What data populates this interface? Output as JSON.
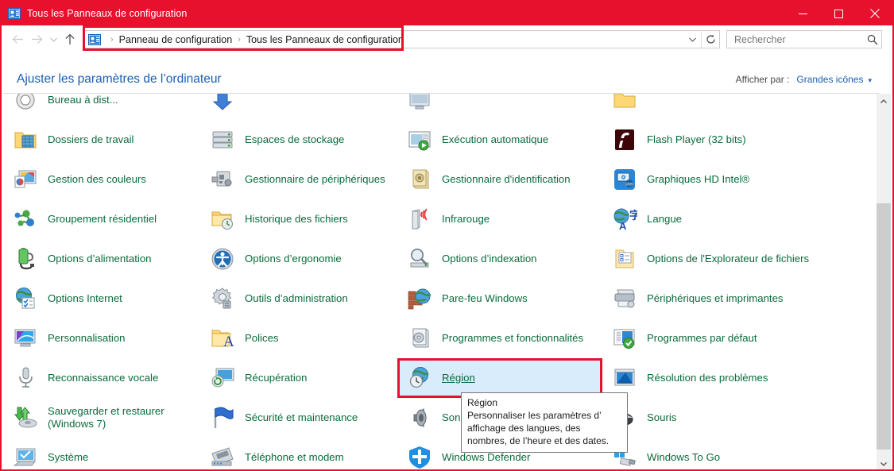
{
  "window": {
    "title": "Tous les Panneaux de configuration",
    "titlebar_color": "#e8112d",
    "icon": "control-panel-icon",
    "minimize_label": "—",
    "maximize_label": "□",
    "close_label": "✕"
  },
  "nav": {
    "back_label": "←",
    "forward_label": "→",
    "recent_label": "⌄",
    "up_label": "↑",
    "refresh_label": "↻",
    "dropdown_label": "⌄",
    "breadcrumb": [
      "Panneau de configuration",
      "Tous les Panneaux de configuration"
    ],
    "separator": "›"
  },
  "search": {
    "placeholder": "Rechercher",
    "value": "",
    "icon": "search-icon"
  },
  "header": {
    "heading": "Ajuster les paramètres de l’ordinateur",
    "view_by_label": "Afficher par :",
    "view_by_value": "Grandes icônes",
    "view_by_caret": "▾"
  },
  "grid": {
    "partial_top_row": [
      {
        "label": "Bureau à dist...",
        "icon": "remote-desktop-icon"
      },
      {
        "label": "",
        "icon": "windows-update-icon"
      },
      {
        "label": "",
        "icon": "display-icon"
      },
      {
        "label": "",
        "icon": "folder-small-icon"
      }
    ],
    "rows": [
      [
        {
          "label": "Dossiers de travail",
          "icon": "work-folders-icon"
        },
        {
          "label": "Espaces de stockage",
          "icon": "storage-spaces-icon"
        },
        {
          "label": "Exécution automatique",
          "icon": "autoplay-icon"
        },
        {
          "label": "Flash Player (32 bits)",
          "icon": "flash-player-icon"
        }
      ],
      [
        {
          "label": "Gestion des couleurs",
          "icon": "color-management-icon"
        },
        {
          "label": "Gestionnaire de périphériques",
          "icon": "device-manager-icon"
        },
        {
          "label": "Gestionnaire d'identification",
          "icon": "credential-manager-icon"
        },
        {
          "label": "Graphiques HD Intel®",
          "icon": "intel-hd-graphics-icon"
        }
      ],
      [
        {
          "label": "Groupement résidentiel",
          "icon": "homegroup-icon"
        },
        {
          "label": "Historique des fichiers",
          "icon": "file-history-icon"
        },
        {
          "label": "Infrarouge",
          "icon": "infrared-icon"
        },
        {
          "label": "Langue",
          "icon": "language-icon"
        }
      ],
      [
        {
          "label": "Options d’alimentation",
          "icon": "power-options-icon"
        },
        {
          "label": "Options d’ergonomie",
          "icon": "ease-of-access-icon"
        },
        {
          "label": "Options d’indexation",
          "icon": "indexing-options-icon"
        },
        {
          "label": "Options de l'Explorateur de fichiers",
          "icon": "file-explorer-options-icon"
        }
      ],
      [
        {
          "label": "Options Internet",
          "icon": "internet-options-icon"
        },
        {
          "label": "Outils d’administration",
          "icon": "admin-tools-icon"
        },
        {
          "label": "Pare-feu Windows",
          "icon": "windows-firewall-icon"
        },
        {
          "label": "Périphériques et imprimantes",
          "icon": "devices-printers-icon"
        }
      ],
      [
        {
          "label": "Personnalisation",
          "icon": "personalization-icon"
        },
        {
          "label": "Polices",
          "icon": "fonts-icon"
        },
        {
          "label": "Programmes et fonctionnalités",
          "icon": "programs-features-icon"
        },
        {
          "label": "Programmes par défaut",
          "icon": "default-programs-icon"
        }
      ],
      [
        {
          "label": "Reconnaissance vocale",
          "icon": "speech-recognition-icon"
        },
        {
          "label": "Récupération",
          "icon": "recovery-icon"
        },
        {
          "label": "Région",
          "icon": "region-icon",
          "highlighted": true
        },
        {
          "label": "Résolution des problèmes",
          "icon": "troubleshooting-icon"
        }
      ],
      [
        {
          "label": "Sauvegarder et restaurer (Windows 7)",
          "icon": "backup-restore-icon"
        },
        {
          "label": "Sécurité et maintenance",
          "icon": "security-maintenance-icon"
        },
        {
          "label": "Son",
          "icon": "sound-icon"
        },
        {
          "label": "Souris",
          "icon": "mouse-icon"
        }
      ],
      [
        {
          "label": "Système",
          "icon": "system-icon"
        },
        {
          "label": "Téléphone et modem",
          "icon": "phone-modem-icon"
        },
        {
          "label": "Windows Defender",
          "icon": "windows-defender-icon"
        },
        {
          "label": "Windows To Go",
          "icon": "windows-to-go-icon"
        }
      ]
    ]
  },
  "tooltip": {
    "title": "Région",
    "body": "Personnaliser les paramètres d’ affichage des langues, des nombres, de l’heure et des dates."
  },
  "scrollbar": {
    "up_label": "˄",
    "down_label": "˅"
  },
  "colors": {
    "accent": "#e8112d",
    "link": "#1a5fb4",
    "item_text": "#0a6b3d",
    "selection": "#d9ecfb"
  }
}
